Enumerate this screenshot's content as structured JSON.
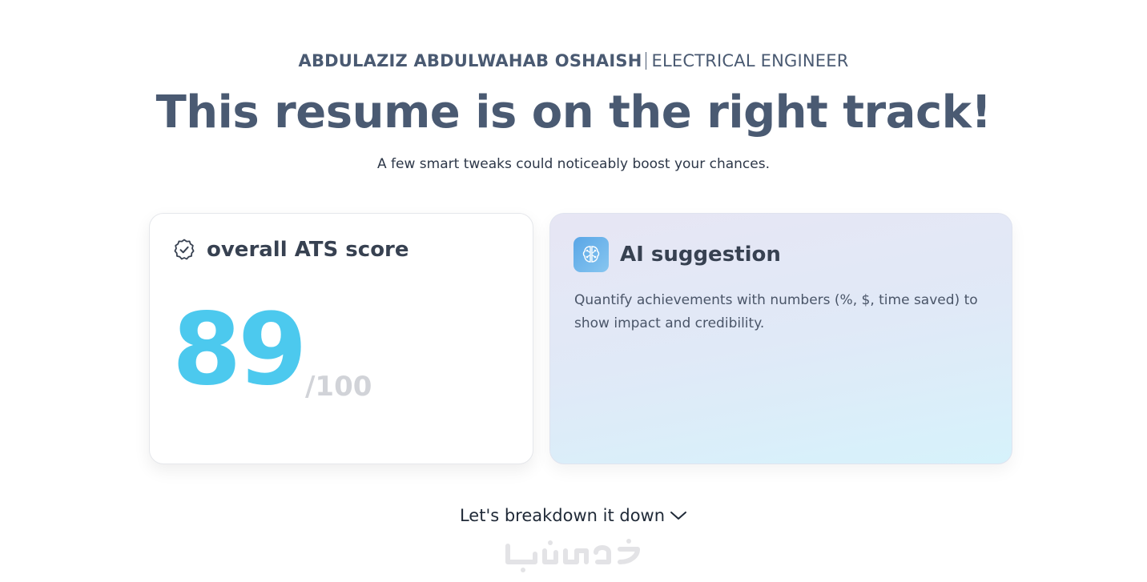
{
  "header": {
    "name": "ABDULAZIZ ABDULWAHAB OSHAISH",
    "role": "ELECTRICAL ENGINEER"
  },
  "headline": "This resume is on the right track!",
  "subline": "A few smart tweaks could noticeably boost your chances.",
  "score_card": {
    "title": "overall ATS score",
    "score": "89",
    "total": "/100",
    "icon": "badge-check-icon",
    "accent_color": "#4cc9ee"
  },
  "ai_card": {
    "title": "AI suggestion",
    "icon": "ai-brain-icon",
    "text": "Quantify achievements with numbers (%, $, time saved) to show impact and credibility."
  },
  "breakdown": {
    "label": "Let's breakdown it down",
    "icon": "chevron-down-icon"
  },
  "watermark": {
    "text": "خمسات"
  }
}
